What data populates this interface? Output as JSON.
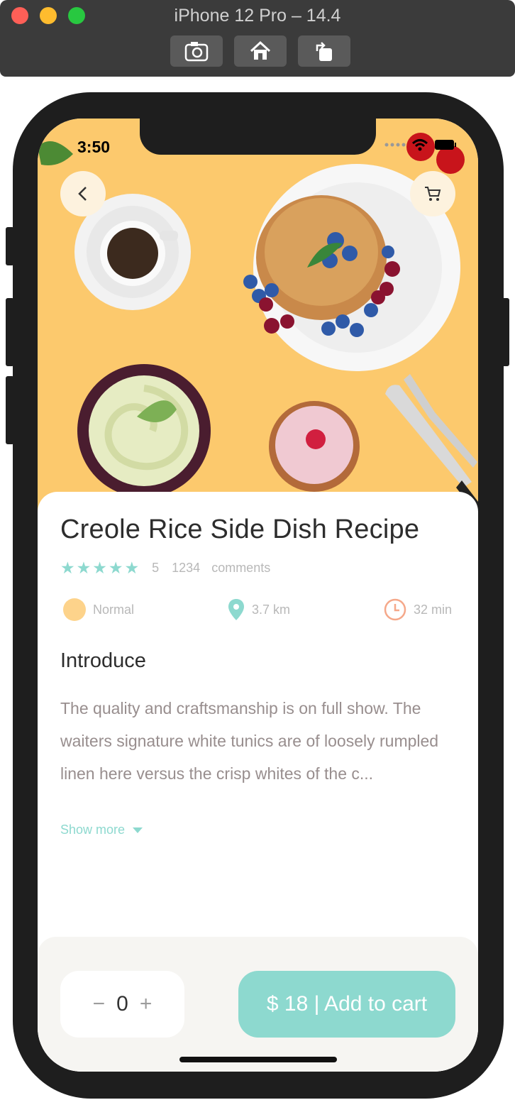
{
  "simulator": {
    "title": "iPhone 12 Pro – 14.4"
  },
  "status": {
    "time": "3:50"
  },
  "recipe": {
    "title": "Creole Rice Side Dish Recipe",
    "rating_value": "5",
    "comment_count": "1234",
    "comments_label": "comments",
    "stars": 5
  },
  "meta": {
    "difficulty": "Normal",
    "distance": "3.7 km",
    "duration": "32 min"
  },
  "intro": {
    "heading": "Introduce",
    "text": "The quality and craftsmanship is on full show. The waiters  signature white tunics are of loosely rumpled linen here versus the crisp whites of the c...",
    "show_more": "Show more"
  },
  "cart": {
    "quantity": "0",
    "minus": "−",
    "plus": "+",
    "add_label": "$ 18 | Add to cart"
  },
  "colors": {
    "accent": "#8dd9cf",
    "hero_bg": "#fcc96d",
    "dot": "#fdd38b",
    "clock": "#f5a88a"
  }
}
